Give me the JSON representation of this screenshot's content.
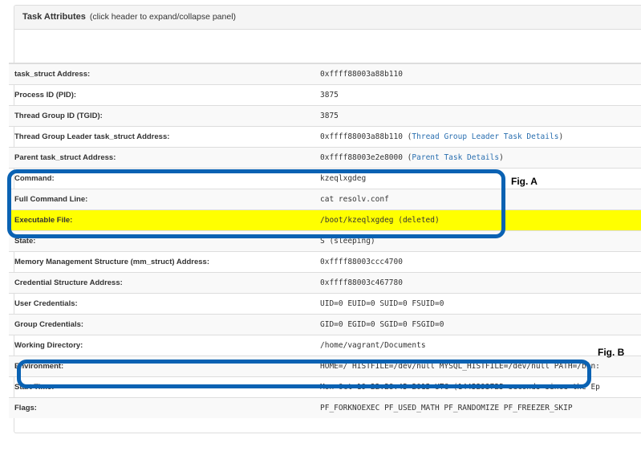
{
  "panel": {
    "title": "Task Attributes",
    "hint": "(click header to expand/collapse panel)"
  },
  "rows": [
    {
      "label": "task_struct Address:",
      "value": "0xffff88003a88b110"
    },
    {
      "label": "Process ID (PID):",
      "value": "3875"
    },
    {
      "label": "Thread Group ID (TGID):",
      "value": "3875"
    },
    {
      "label": "Thread Group Leader task_struct Address:",
      "value": "0xffff88003a88b110",
      "pre": " (",
      "link": "Thread Group Leader Task Details",
      "post": ")"
    },
    {
      "label": "Parent task_struct Address:",
      "value": "0xffff88003e2e8000",
      "pre": " (",
      "link": "Parent Task Details",
      "post": ")"
    },
    {
      "label": "Command:",
      "value": "kzeqlxgdeg"
    },
    {
      "label": "Full Command Line:",
      "value": "cat resolv.conf"
    },
    {
      "label": "Executable File:",
      "value": "/boot/kzeqlxgdeg (deleted)",
      "highlight": true
    },
    {
      "label": "State:",
      "value": "S (sleeping)"
    },
    {
      "label": "Memory Management Structure (mm_struct) Address:",
      "value": "0xffff88003ccc4700"
    },
    {
      "label": "Credential Structure Address:",
      "value": "0xffff88003c467780"
    },
    {
      "label": "User Credentials:",
      "value": "UID=0 EUID=0 SUID=0 FSUID=0"
    },
    {
      "label": "Group Credentials:",
      "value": "GID=0 EGID=0 SGID=0 FSGID=0"
    },
    {
      "label": "Working Directory:",
      "value": "/home/vagrant/Documents"
    },
    {
      "label": "Environment:",
      "value": "HOME=/ HISTFILE=/dev/null MYSQL_HISTFILE=/dev/null PATH=/bin:"
    },
    {
      "label": "Start Time:",
      "value": "Mon Oct 19 22:28:45 2015 UTC (1445293725 seconds since the Ep"
    },
    {
      "label": "Flags:",
      "value": "PF_FORKNOEXEC PF_USED_MATH PF_RANDOMIZE PF_FREEZER_SKIP"
    }
  ],
  "annotations": {
    "fig_a": "Fig. A",
    "fig_b": "Fig. B",
    "highlight_color": "#ffff00",
    "callout_color": "#0a62b3"
  }
}
